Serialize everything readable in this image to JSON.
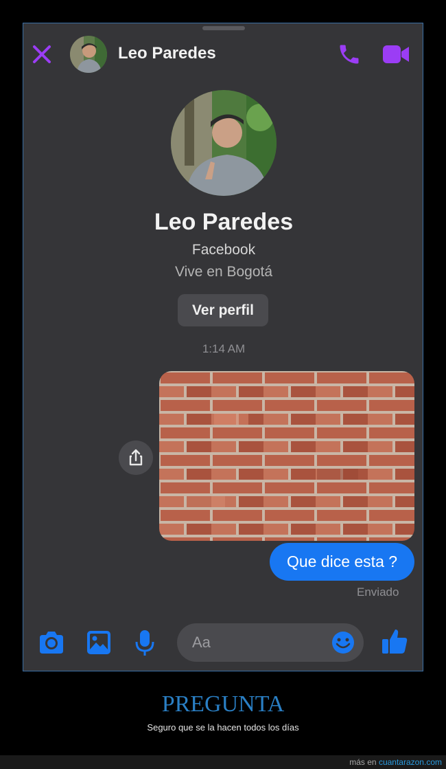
{
  "header": {
    "contact_name": "Leo Paredes",
    "close_icon": "close-icon",
    "call_icon": "phone-icon",
    "video_icon": "video-camera-icon"
  },
  "profile": {
    "name": "Leo Paredes",
    "source": "Facebook",
    "location": "Vive en Bogotá",
    "view_profile_label": "Ver perfil"
  },
  "conversation": {
    "timestamp": "1:14 AM",
    "messages": [
      {
        "type": "image",
        "description_icon": "brick-wall-photo",
        "share_icon": "share-icon"
      },
      {
        "type": "text",
        "text": "Que dice esta ?"
      }
    ],
    "status": "Enviado"
  },
  "composer": {
    "placeholder": "Aa",
    "icons": [
      "camera-icon",
      "gallery-icon",
      "microphone-icon",
      "emoji-icon",
      "thumbs-up-icon"
    ]
  },
  "footer": {
    "title": "PREGUNTA",
    "subtitle": "Seguro que se la hacen todos los días",
    "credit_prefix": "más en",
    "credit_link": "cuantarazon.com"
  },
  "colors": {
    "accent_purple": "#9b3df5",
    "messenger_blue": "#1877f2",
    "background": "#353538",
    "footer_title": "#2a7fc4"
  }
}
